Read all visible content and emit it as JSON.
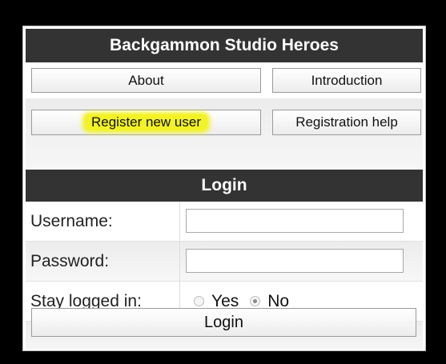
{
  "app": {
    "title": "Backgammon Studio Heroes"
  },
  "nav": {
    "about_label": "About",
    "introduction_label": "Introduction",
    "register_label": "Register new user",
    "registration_help_label": "Registration help"
  },
  "login": {
    "section_title": "Login",
    "username_label": "Username:",
    "username_value": "",
    "password_label": "Password:",
    "password_value": "",
    "stay_logged_in_label": "Stay logged in:",
    "stay_logged_in_options": [
      "Yes",
      "No"
    ],
    "stay_logged_in_selected": "No",
    "submit_label": "Login"
  },
  "colors": {
    "header_bg": "#333333",
    "highlight": "#f2f227",
    "page_bg": "#000000"
  }
}
